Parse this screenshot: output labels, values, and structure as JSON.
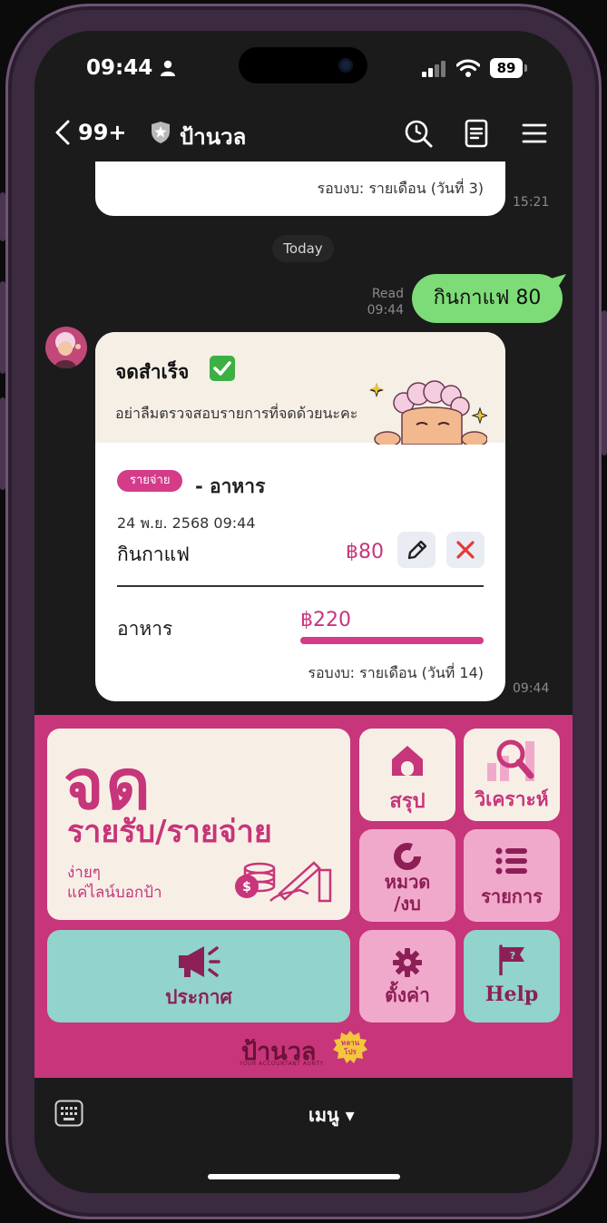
{
  "status_bar": {
    "time": "09:44",
    "battery": "89"
  },
  "header": {
    "back_count": "99+",
    "title": "ป้านวล"
  },
  "chat": {
    "previous_card": {
      "cycle_label": "รอบงบ: รายเดือน (วันที่ 3)",
      "time": "15:21"
    },
    "date_separator": "Today",
    "sent_message": {
      "text": "กินกาแฟ 80",
      "read_label": "Read",
      "time": "09:44"
    },
    "record_card": {
      "title": "จดสำเร็จ",
      "subtitle": "อย่าลืมตรวจสอบรายการที่จดด้วยนะคะ",
      "tag": "รายจ่าย",
      "category": "- อาหาร",
      "entry_date": "24 พ.ย. 2568 09:44",
      "entry_name": "กินกาแฟ",
      "entry_amount": "฿80",
      "budget_name": "อาหาร",
      "budget_amount": "฿220",
      "budget_progress": 1.0,
      "cycle_label": "รอบงบ: รายเดือน (วันที่ 14)",
      "time": "09:44"
    }
  },
  "rich_menu": {
    "record": {
      "title": "จด",
      "subtitle": "รายรับ/รายจ่าย",
      "note": "ง่ายๆ\nแค่ไลน์บอกป้า"
    },
    "summary": "สรุป",
    "analyze": "วิเคราะห์",
    "category_budget": "หมวด\n/งบ",
    "transactions": "รายการ",
    "announce": "ประกาศ",
    "settings": "ตั้งค่า",
    "help": "Help",
    "brand": "ป้านวล",
    "brand_tagline": "YOUR ACCOUNTANT AUNTY",
    "brand_badge": "หลานโปร"
  },
  "bottom": {
    "menu_label": "เมนู ▾"
  },
  "colors": {
    "accent": "#c7357a",
    "sent_bubble": "#7ddc77",
    "teal": "#92d3cc",
    "rose": "#f1a9cb",
    "cream": "#f7efe6"
  }
}
